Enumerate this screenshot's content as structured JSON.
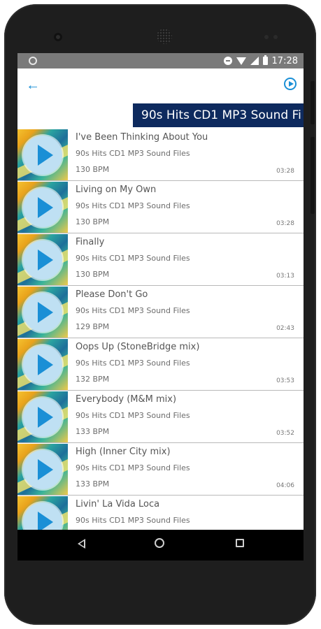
{
  "status_bar": {
    "time": "17:28"
  },
  "app_bar": {
    "back_icon": "arrow-back-icon",
    "play_icon": "play-circle-icon"
  },
  "banner": {
    "title": "90s Hits CD1 MP3 Sound Fi"
  },
  "tracks": [
    {
      "title": "I've Been Thinking About You",
      "album": "90s Hits CD1 MP3 Sound Files",
      "bpm": "130 BPM",
      "duration": "03:28"
    },
    {
      "title": "Living on My Own",
      "album": "90s Hits CD1 MP3 Sound Files",
      "bpm": "130 BPM",
      "duration": "03:28"
    },
    {
      "title": "Finally",
      "album": "90s Hits CD1 MP3 Sound Files",
      "bpm": "130 BPM",
      "duration": "03:13"
    },
    {
      "title": "Please Don't Go",
      "album": "90s Hits CD1 MP3 Sound Files",
      "bpm": "129 BPM",
      "duration": "02:43"
    },
    {
      "title": "Oops Up (StoneBridge mix)",
      "album": "90s Hits CD1 MP3 Sound Files",
      "bpm": "132 BPM",
      "duration": "03:53"
    },
    {
      "title": "Everybody (M&M mix)",
      "album": "90s Hits CD1 MP3 Sound Files",
      "bpm": "133 BPM",
      "duration": "03:52"
    },
    {
      "title": "High (Inner City mix)",
      "album": "90s Hits CD1 MP3 Sound Files",
      "bpm": "133 BPM",
      "duration": "04:06"
    },
    {
      "title": "Livin' La Vida Loca",
      "album": "90s Hits CD1 MP3 Sound Files",
      "bpm": "",
      "duration": ""
    }
  ],
  "colors": {
    "accent": "#1a8fd6",
    "banner_bg": "#0e2a5e",
    "status_bar": "#7a7a7a"
  }
}
